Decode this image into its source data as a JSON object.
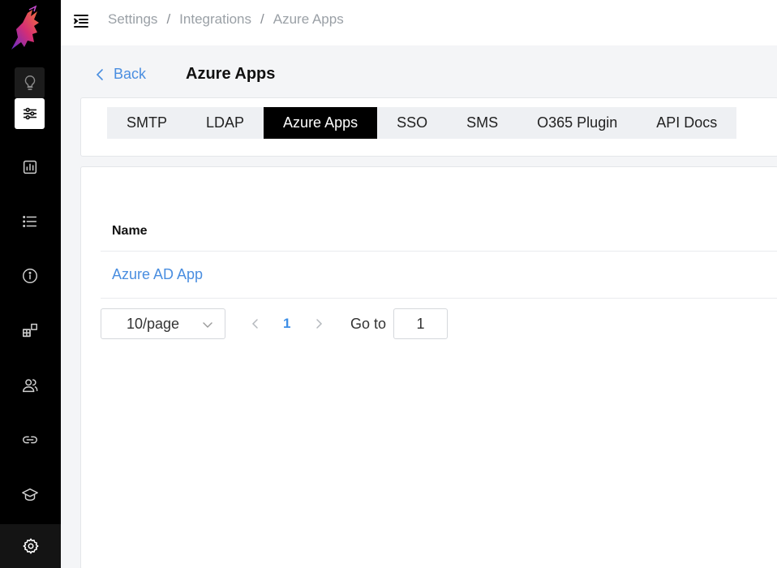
{
  "sidebar": {
    "items": [
      {
        "name": "lightbulb-icon"
      },
      {
        "name": "sliders-icon"
      },
      {
        "name": "chart-icon"
      },
      {
        "name": "list-icon"
      },
      {
        "name": "info-icon"
      },
      {
        "name": "modules-icon"
      },
      {
        "name": "users-icon"
      },
      {
        "name": "link-icon"
      },
      {
        "name": "graduation-cap-icon"
      },
      {
        "name": "gear-icon"
      }
    ]
  },
  "header": {
    "breadcrumb": [
      "Settings",
      "Integrations",
      "Azure Apps"
    ],
    "separator": "/"
  },
  "page": {
    "back_label": "Back",
    "title": "Azure Apps"
  },
  "tabs": [
    "SMTP",
    "LDAP",
    "Azure Apps",
    "SSO",
    "SMS",
    "O365 Plugin",
    "API Docs"
  ],
  "active_tab": "Azure Apps",
  "table": {
    "columns": [
      "Name"
    ],
    "rows": [
      [
        "Azure AD App"
      ]
    ]
  },
  "pagination": {
    "page_size": "10/page",
    "current_page": "1",
    "goto_label": "Go to",
    "goto_value": "1"
  },
  "colors": {
    "sidebar_bg": "#000000",
    "accent": "#4a8ee0",
    "active_tab_bg": "#000000"
  }
}
